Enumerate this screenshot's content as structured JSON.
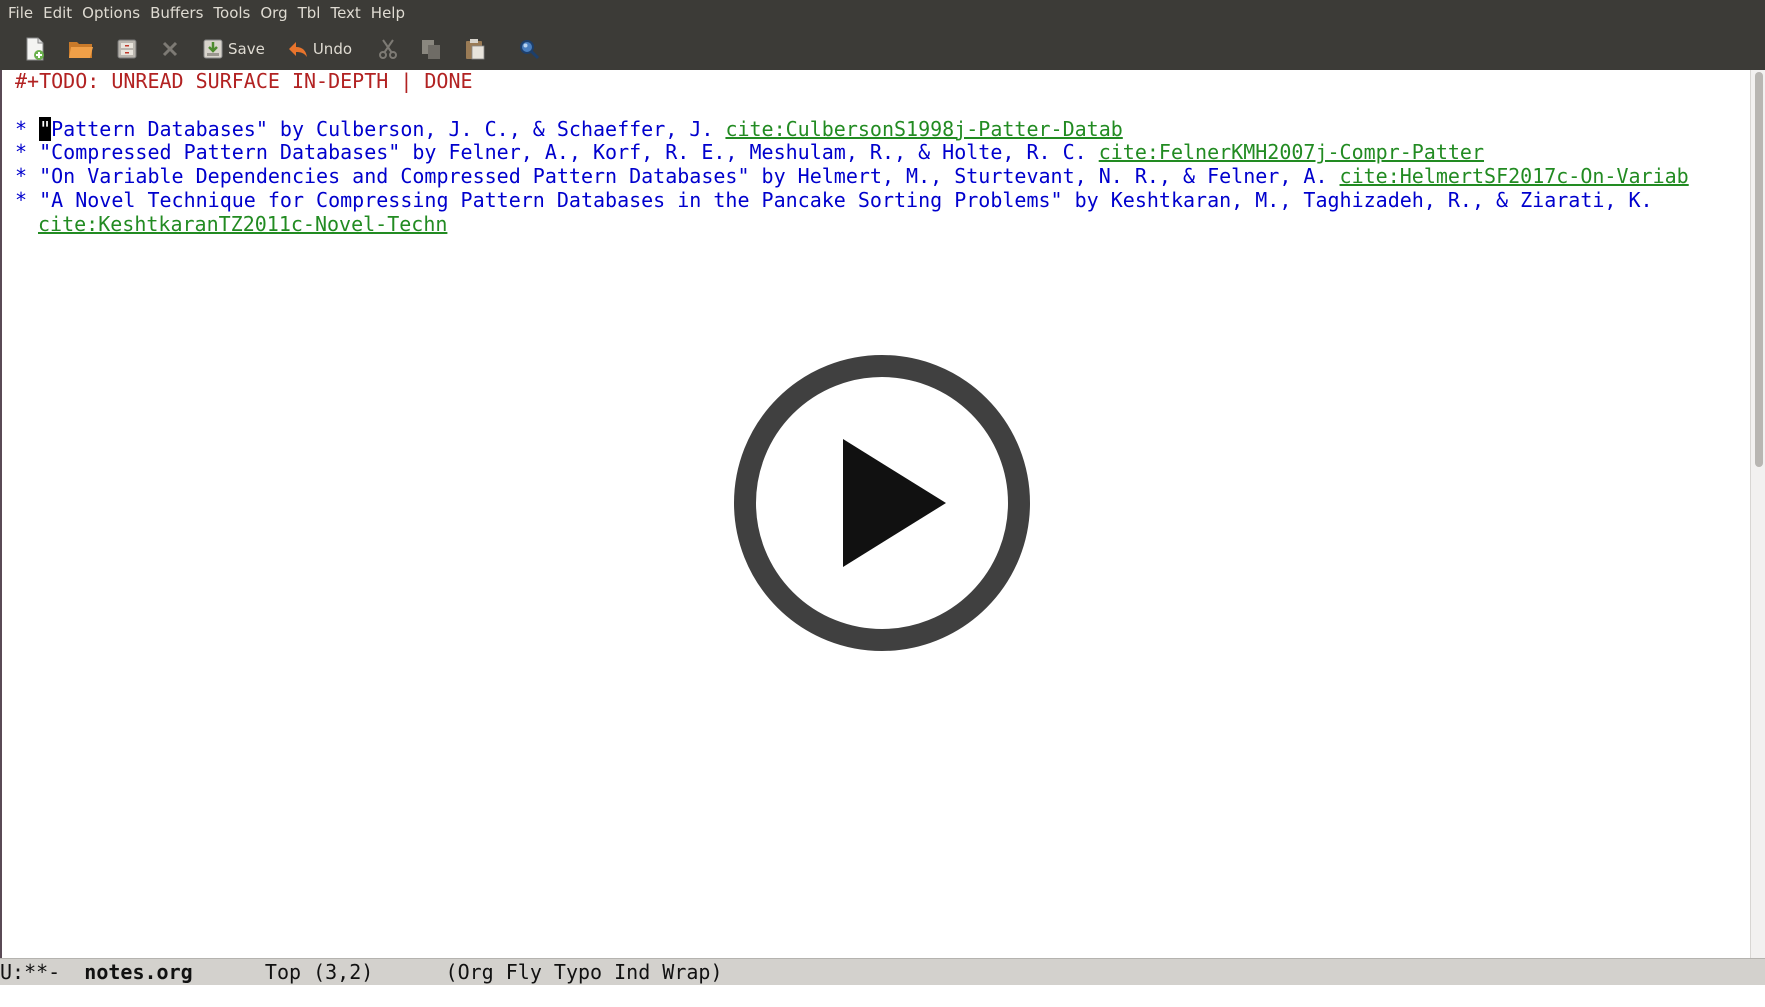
{
  "menu": [
    "File",
    "Edit",
    "Options",
    "Buffers",
    "Tools",
    "Org",
    "Tbl",
    "Text",
    "Help"
  ],
  "toolbar": {
    "save_label": "Save",
    "undo_label": "Undo"
  },
  "buffer": {
    "todo_line": "#+TODO: UNREAD SURFACE IN-DEPTH | DONE",
    "entries": [
      {
        "star": "* ",
        "first_char": "\"",
        "text": "Pattern Databases\" by Culberson, J. C., & Schaeffer, J. ",
        "cite": "cite:CulbersonS1998j-Patter-Datab"
      },
      {
        "star": "* ",
        "text": "\"Compressed Pattern Databases\" by Felner, A., Korf, R. E., Meshulam, R., & Holte, R. C. ",
        "cite": "cite:FelnerKMH2007j-Compr-Patter"
      },
      {
        "star": "* ",
        "text": "\"On Variable Dependencies and Compressed Pattern Databases\" by Helmert, M., Sturtevant, N. R., & Felner, A. ",
        "cite": "cite:HelmertSF2017c-On-Variab"
      },
      {
        "star": "* ",
        "text": "\"A Novel Technique for Compressing Pattern Databases in the Pancake Sorting Problems\" by Keshtkaran, M., Taghizadeh, R., & Ziarati, K.",
        "cite": "cite:KeshtkaranTZ2011c-Novel-Techn"
      }
    ]
  },
  "modeline": {
    "status": "U:**-  ",
    "buffer_name": "notes.org",
    "position": "      Top (3,2)      ",
    "modes": "(Org Fly Typo Ind Wrap)"
  },
  "colors": {
    "todo": "#b22222",
    "heading": "#0000cd",
    "cite": "#228b22",
    "toolbar_bg": "#3c3b37",
    "play_button": "#404040"
  },
  "overlay": {
    "icon": "play-button-icon"
  }
}
